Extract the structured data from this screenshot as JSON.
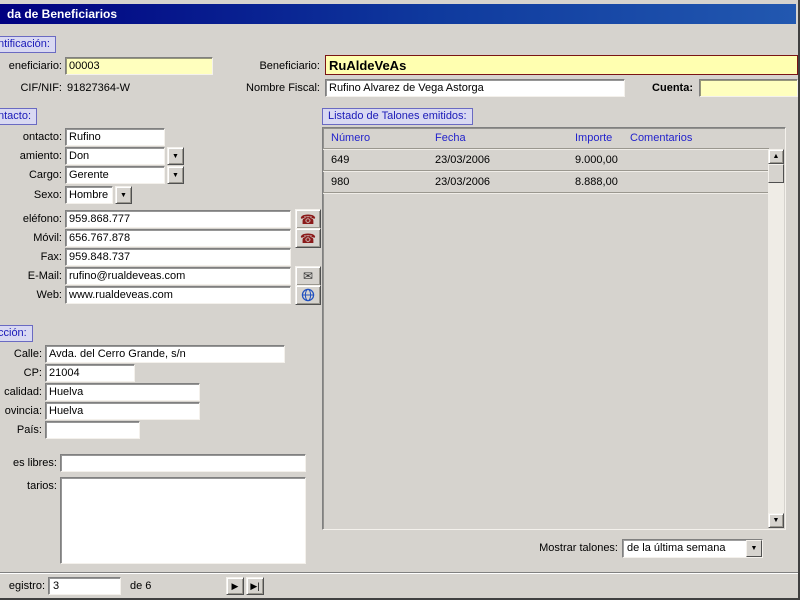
{
  "window": {
    "title": "da de Beneficiarios"
  },
  "identificacion": {
    "section_label": "ntificación:",
    "code": {
      "label": "eneficiario:",
      "value": "00003"
    },
    "beneficiario": {
      "label": "Beneficiario:",
      "value": "RuAldeVeAs"
    },
    "cif": {
      "label": "CIF/NIF:",
      "value": "91827364-W"
    },
    "nombre_fiscal": {
      "label": "Nombre Fiscal:",
      "value": "Rufino Alvarez de Vega Astorga"
    },
    "cuenta": {
      "label": "Cuenta:",
      "value": ""
    }
  },
  "contacto": {
    "section_label": "ntacto:",
    "persona": {
      "label": "ontacto:",
      "value": "Rufino"
    },
    "tratamiento": {
      "label": "amiento:",
      "value": "Don"
    },
    "cargo": {
      "label": "Cargo:",
      "value": "Gerente"
    },
    "sexo": {
      "label": "Sexo:",
      "value": "Hombre"
    },
    "telefono": {
      "label": "eléfono:",
      "value": "959.868.777"
    },
    "movil": {
      "label": "Móvil:",
      "value": "656.767.878"
    },
    "fax": {
      "label": "Fax:",
      "value": "959.848.737"
    },
    "email": {
      "label": "E-Mail:",
      "value": "rufino@rualdeveas.com"
    },
    "web": {
      "label": "Web:",
      "value": "www.rualdeveas.com"
    }
  },
  "direccion": {
    "section_label": "cción:",
    "calle": {
      "label": "Calle:",
      "value": "Avda. del Cerro Grande, s/n"
    },
    "cp": {
      "label": "CP:",
      "value": "21004"
    },
    "localidad": {
      "label": "calidad:",
      "value": "Huelva"
    },
    "provincia": {
      "label": "ovincia:",
      "value": "Huelva"
    },
    "pais": {
      "label": "País:",
      "value": ""
    }
  },
  "notas": {
    "libres": {
      "label": "es libres:",
      "value": ""
    },
    "comentarios": {
      "label": "tarios:",
      "value": ""
    }
  },
  "talones": {
    "section_label": "Listado de Talones emitidos:",
    "columns": [
      "Número",
      "Fecha",
      "Importe",
      "Comentarios"
    ],
    "rows": [
      {
        "numero": "649",
        "fecha": "23/03/2006",
        "importe": "9.000,00",
        "comentarios": ""
      },
      {
        "numero": "980",
        "fecha": "23/03/2006",
        "importe": "8.888,00",
        "comentarios": ""
      }
    ],
    "filter": {
      "label": "Mostrar talones:",
      "value": "de la última semana"
    }
  },
  "record_nav": {
    "label": "egistro:",
    "current": "3",
    "of_label": "de 6"
  },
  "icons": {
    "dropdown": "▼",
    "phone": "☎",
    "email": "✉",
    "scroll_up": "▲",
    "scroll_down": "▼",
    "next": "▶",
    "last": "▶|"
  },
  "colors": {
    "titlebar": "#000080",
    "form_bg": "#d6d3ce",
    "field_yellow": "#ffffbe",
    "section_bg": "#d9d9f2",
    "section_text": "#1a1ab8",
    "table_header_text": "#2222cc",
    "highlight_border": "#7a1414"
  }
}
